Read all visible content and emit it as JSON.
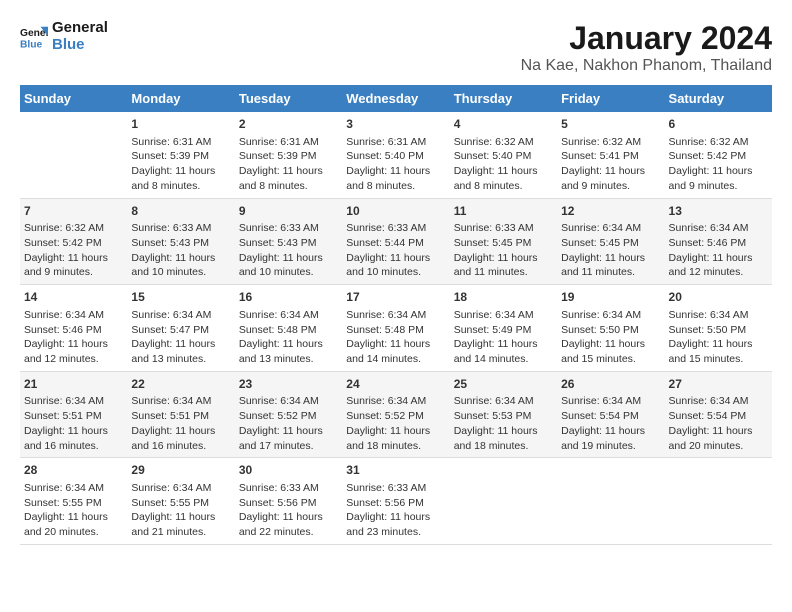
{
  "header": {
    "logo_line1": "General",
    "logo_line2": "Blue",
    "title": "January 2024",
    "subtitle": "Na Kae, Nakhon Phanom, Thailand"
  },
  "calendar": {
    "days_of_week": [
      "Sunday",
      "Monday",
      "Tuesday",
      "Wednesday",
      "Thursday",
      "Friday",
      "Saturday"
    ],
    "weeks": [
      [
        {
          "day": "",
          "lines": []
        },
        {
          "day": "1",
          "lines": [
            "Sunrise: 6:31 AM",
            "Sunset: 5:39 PM",
            "Daylight: 11 hours",
            "and 8 minutes."
          ]
        },
        {
          "day": "2",
          "lines": [
            "Sunrise: 6:31 AM",
            "Sunset: 5:39 PM",
            "Daylight: 11 hours",
            "and 8 minutes."
          ]
        },
        {
          "day": "3",
          "lines": [
            "Sunrise: 6:31 AM",
            "Sunset: 5:40 PM",
            "Daylight: 11 hours",
            "and 8 minutes."
          ]
        },
        {
          "day": "4",
          "lines": [
            "Sunrise: 6:32 AM",
            "Sunset: 5:40 PM",
            "Daylight: 11 hours",
            "and 8 minutes."
          ]
        },
        {
          "day": "5",
          "lines": [
            "Sunrise: 6:32 AM",
            "Sunset: 5:41 PM",
            "Daylight: 11 hours",
            "and 9 minutes."
          ]
        },
        {
          "day": "6",
          "lines": [
            "Sunrise: 6:32 AM",
            "Sunset: 5:42 PM",
            "Daylight: 11 hours",
            "and 9 minutes."
          ]
        }
      ],
      [
        {
          "day": "7",
          "lines": [
            "Sunrise: 6:32 AM",
            "Sunset: 5:42 PM",
            "Daylight: 11 hours",
            "and 9 minutes."
          ]
        },
        {
          "day": "8",
          "lines": [
            "Sunrise: 6:33 AM",
            "Sunset: 5:43 PM",
            "Daylight: 11 hours",
            "and 10 minutes."
          ]
        },
        {
          "day": "9",
          "lines": [
            "Sunrise: 6:33 AM",
            "Sunset: 5:43 PM",
            "Daylight: 11 hours",
            "and 10 minutes."
          ]
        },
        {
          "day": "10",
          "lines": [
            "Sunrise: 6:33 AM",
            "Sunset: 5:44 PM",
            "Daylight: 11 hours",
            "and 10 minutes."
          ]
        },
        {
          "day": "11",
          "lines": [
            "Sunrise: 6:33 AM",
            "Sunset: 5:45 PM",
            "Daylight: 11 hours",
            "and 11 minutes."
          ]
        },
        {
          "day": "12",
          "lines": [
            "Sunrise: 6:34 AM",
            "Sunset: 5:45 PM",
            "Daylight: 11 hours",
            "and 11 minutes."
          ]
        },
        {
          "day": "13",
          "lines": [
            "Sunrise: 6:34 AM",
            "Sunset: 5:46 PM",
            "Daylight: 11 hours",
            "and 12 minutes."
          ]
        }
      ],
      [
        {
          "day": "14",
          "lines": [
            "Sunrise: 6:34 AM",
            "Sunset: 5:46 PM",
            "Daylight: 11 hours",
            "and 12 minutes."
          ]
        },
        {
          "day": "15",
          "lines": [
            "Sunrise: 6:34 AM",
            "Sunset: 5:47 PM",
            "Daylight: 11 hours",
            "and 13 minutes."
          ]
        },
        {
          "day": "16",
          "lines": [
            "Sunrise: 6:34 AM",
            "Sunset: 5:48 PM",
            "Daylight: 11 hours",
            "and 13 minutes."
          ]
        },
        {
          "day": "17",
          "lines": [
            "Sunrise: 6:34 AM",
            "Sunset: 5:48 PM",
            "Daylight: 11 hours",
            "and 14 minutes."
          ]
        },
        {
          "day": "18",
          "lines": [
            "Sunrise: 6:34 AM",
            "Sunset: 5:49 PM",
            "Daylight: 11 hours",
            "and 14 minutes."
          ]
        },
        {
          "day": "19",
          "lines": [
            "Sunrise: 6:34 AM",
            "Sunset: 5:50 PM",
            "Daylight: 11 hours",
            "and 15 minutes."
          ]
        },
        {
          "day": "20",
          "lines": [
            "Sunrise: 6:34 AM",
            "Sunset: 5:50 PM",
            "Daylight: 11 hours",
            "and 15 minutes."
          ]
        }
      ],
      [
        {
          "day": "21",
          "lines": [
            "Sunrise: 6:34 AM",
            "Sunset: 5:51 PM",
            "Daylight: 11 hours",
            "and 16 minutes."
          ]
        },
        {
          "day": "22",
          "lines": [
            "Sunrise: 6:34 AM",
            "Sunset: 5:51 PM",
            "Daylight: 11 hours",
            "and 16 minutes."
          ]
        },
        {
          "day": "23",
          "lines": [
            "Sunrise: 6:34 AM",
            "Sunset: 5:52 PM",
            "Daylight: 11 hours",
            "and 17 minutes."
          ]
        },
        {
          "day": "24",
          "lines": [
            "Sunrise: 6:34 AM",
            "Sunset: 5:52 PM",
            "Daylight: 11 hours",
            "and 18 minutes."
          ]
        },
        {
          "day": "25",
          "lines": [
            "Sunrise: 6:34 AM",
            "Sunset: 5:53 PM",
            "Daylight: 11 hours",
            "and 18 minutes."
          ]
        },
        {
          "day": "26",
          "lines": [
            "Sunrise: 6:34 AM",
            "Sunset: 5:54 PM",
            "Daylight: 11 hours",
            "and 19 minutes."
          ]
        },
        {
          "day": "27",
          "lines": [
            "Sunrise: 6:34 AM",
            "Sunset: 5:54 PM",
            "Daylight: 11 hours",
            "and 20 minutes."
          ]
        }
      ],
      [
        {
          "day": "28",
          "lines": [
            "Sunrise: 6:34 AM",
            "Sunset: 5:55 PM",
            "Daylight: 11 hours",
            "and 20 minutes."
          ]
        },
        {
          "day": "29",
          "lines": [
            "Sunrise: 6:34 AM",
            "Sunset: 5:55 PM",
            "Daylight: 11 hours",
            "and 21 minutes."
          ]
        },
        {
          "day": "30",
          "lines": [
            "Sunrise: 6:33 AM",
            "Sunset: 5:56 PM",
            "Daylight: 11 hours",
            "and 22 minutes."
          ]
        },
        {
          "day": "31",
          "lines": [
            "Sunrise: 6:33 AM",
            "Sunset: 5:56 PM",
            "Daylight: 11 hours",
            "and 23 minutes."
          ]
        },
        {
          "day": "",
          "lines": []
        },
        {
          "day": "",
          "lines": []
        },
        {
          "day": "",
          "lines": []
        }
      ]
    ]
  }
}
